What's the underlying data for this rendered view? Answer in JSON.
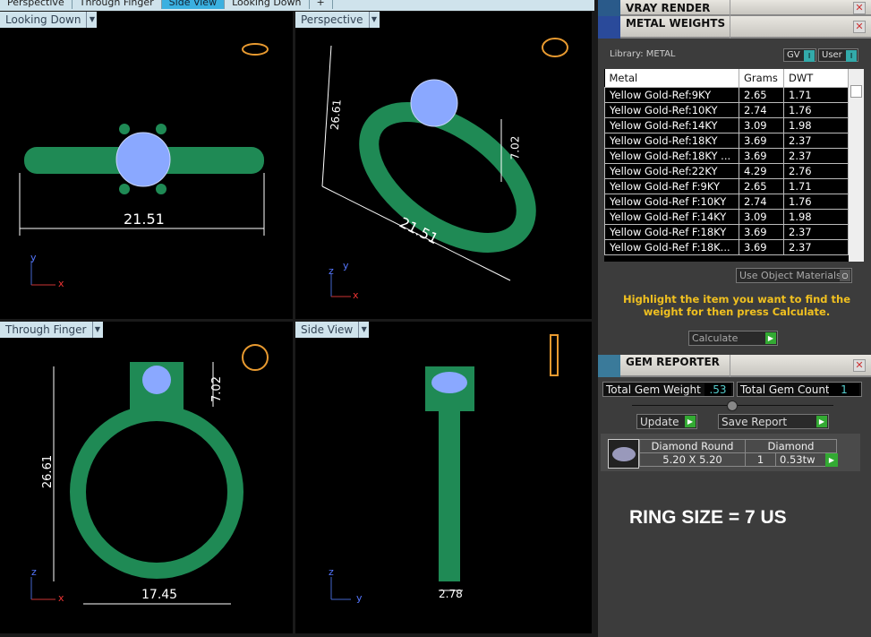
{
  "tabs": [
    "Perspective",
    "Through Finger",
    "Side View",
    "Looking Down",
    "+"
  ],
  "active_tab": "Side View",
  "viewports": {
    "top_left": {
      "label": "Looking Down",
      "dims": [
        "21.51"
      ],
      "axes": [
        "y",
        "x"
      ]
    },
    "top_right": {
      "label": "Perspective",
      "dims": [
        "26.61",
        "7.02",
        "21.51"
      ],
      "axes": [
        "z",
        "y",
        "x"
      ]
    },
    "bottom_left": {
      "label": "Through Finger",
      "dims": [
        "26.61",
        "7.02",
        "17.45"
      ],
      "axes": [
        "z",
        "x"
      ]
    },
    "bottom_right": {
      "label": "Side View",
      "dims": [
        "2.78"
      ],
      "axes": [
        "z",
        "y"
      ]
    }
  },
  "panels": {
    "vray": {
      "title": "VRAY RENDER"
    },
    "metal": {
      "title": "METAL WEIGHTS",
      "library": "Library: METAL",
      "toggle_gv": "GV",
      "toggle_user": "User",
      "columns": [
        "Metal",
        "Grams",
        "DWT"
      ],
      "rows": [
        [
          "Yellow Gold-Ref:9KY",
          "2.65",
          "1.71"
        ],
        [
          "Yellow Gold-Ref:10KY",
          "2.74",
          "1.76"
        ],
        [
          "Yellow Gold-Ref:14KY",
          "3.09",
          "1.98"
        ],
        [
          "Yellow Gold-Ref:18KY",
          "3.69",
          "2.37"
        ],
        [
          "Yellow Gold-Ref:18KY ...",
          "3.69",
          "2.37"
        ],
        [
          "Yellow Gold-Ref:22KY",
          "4.29",
          "2.76"
        ],
        [
          "Yellow Gold-Ref F:9KY",
          "2.65",
          "1.71"
        ],
        [
          "Yellow Gold-Ref F:10KY",
          "2.74",
          "1.76"
        ],
        [
          "Yellow Gold-Ref F:14KY",
          "3.09",
          "1.98"
        ],
        [
          "Yellow Gold-Ref F:18KY",
          "3.69",
          "2.37"
        ],
        [
          "Yellow Gold-Ref F:18K...",
          "3.69",
          "2.37"
        ]
      ],
      "use_object_materials": "Use Object Materials",
      "hint": "Highlight the item you want to find the weight for then press Calculate.",
      "calculate": "Calculate"
    },
    "gem": {
      "title": "GEM REPORTER",
      "total_weight_label": "Total Gem Weight",
      "total_weight": ".53",
      "total_count_label": "Total Gem Count",
      "total_count": "1",
      "update": "Update",
      "save_report": "Save Report",
      "gem_name": "Diamond Round",
      "gem_type": "Diamond",
      "gem_size": "5.20 X 5.20",
      "gem_qty": "1",
      "gem_weight": "0.53tw"
    },
    "ring_size": "RING SIZE = 7 US"
  },
  "colors": {
    "ring": "#1f8a55",
    "gem": "#8aa8ff",
    "hint": "#f0c020",
    "active_tab": "#3ab0e0"
  }
}
